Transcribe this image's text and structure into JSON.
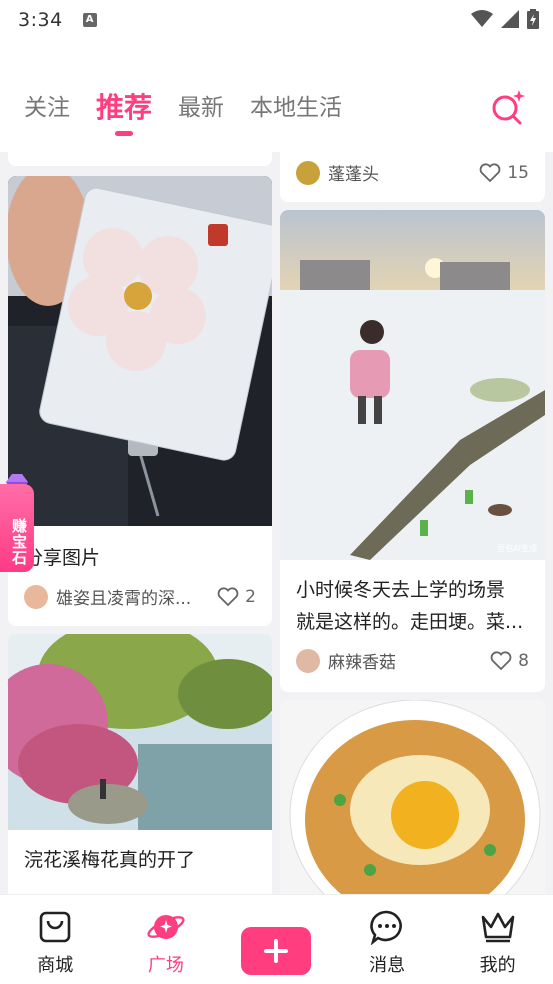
{
  "status_bar": {
    "time": "3:34"
  },
  "tabs": [
    {
      "label": "关注"
    },
    {
      "label": "推荐"
    },
    {
      "label": "最新"
    },
    {
      "label": "本地生活"
    }
  ],
  "badge": {
    "label": "赚宝石"
  },
  "feed": {
    "left": [
      {
        "title": "分享图片",
        "author": "雄姿且凌霄的深...",
        "likes": "2"
      },
      {
        "title": "浣花溪梅花真的开了",
        "author": "",
        "likes": ""
      }
    ],
    "right": [
      {
        "title": "",
        "author": "蓬蓬头",
        "likes": "15"
      },
      {
        "title_line1": "小时候冬天去上学的场景",
        "title_line2": "就是这样的。走田埂。菜...",
        "author": "麻辣香菇",
        "likes": "8",
        "image_caption": "豆包AI生成"
      }
    ]
  },
  "bottom_nav": [
    {
      "label": "商城"
    },
    {
      "label": "广场"
    },
    {
      "label": ""
    },
    {
      "label": "消息"
    },
    {
      "label": "我的"
    }
  ],
  "colors": {
    "accent": "#ff3d7f"
  }
}
